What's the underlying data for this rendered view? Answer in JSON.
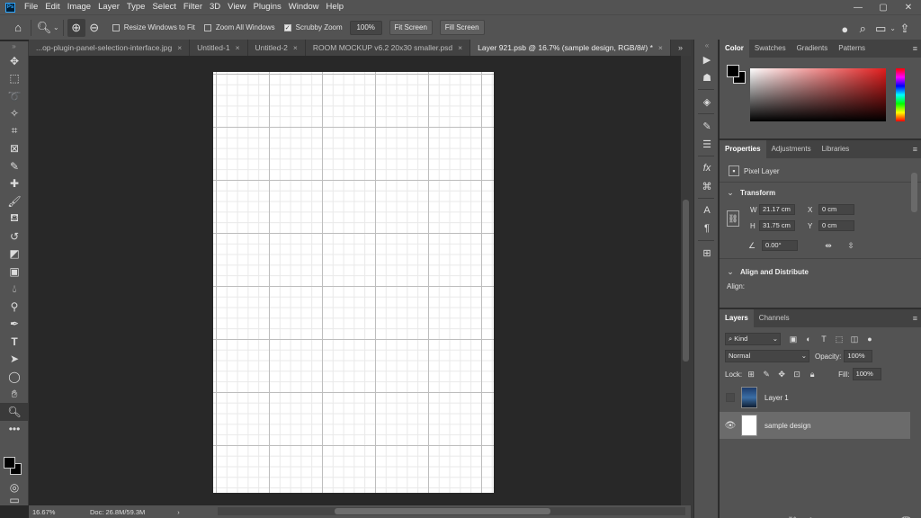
{
  "app": {
    "logo": "Ps"
  },
  "menu": [
    "File",
    "Edit",
    "Image",
    "Layer",
    "Type",
    "Select",
    "Filter",
    "3D",
    "View",
    "Plugins",
    "Window",
    "Help"
  ],
  "window_controls": {
    "minimize": "—",
    "maximize": "▢",
    "close": "✕"
  },
  "options": {
    "resize_windows": "Resize Windows to Fit",
    "zoom_all": "Zoom All Windows",
    "scrubby_zoom": "Scrubby Zoom",
    "zoom_value": "100%",
    "fit_screen": "Fit Screen",
    "fill_screen": "Fill Screen"
  },
  "tabs": [
    {
      "label": "...op-plugin-panel-selection-interface.jpg",
      "active": false
    },
    {
      "label": "Untitled-1",
      "active": false
    },
    {
      "label": "Untitled-2",
      "active": false
    },
    {
      "label": "ROOM MOCKUP v6.2 20x30 smaller.psd",
      "active": false
    },
    {
      "label": "Layer 921.psb @ 16.7% (sample design, RGB/8#) *",
      "active": true
    }
  ],
  "status": {
    "zoom": "16.67%",
    "doc": "Doc: 26.8M/59.3M",
    "arrow": "›"
  },
  "color_panel": {
    "tabs": [
      "Color",
      "Swatches",
      "Gradients",
      "Patterns"
    ]
  },
  "properties_panel": {
    "tabs": [
      "Properties",
      "Adjustments",
      "Libraries"
    ],
    "layer_type": "Pixel Layer",
    "transform_title": "Transform",
    "w_label": "W",
    "w_value": "21.17 cm",
    "h_label": "H",
    "h_value": "31.75 cm",
    "x_label": "X",
    "x_value": "0 cm",
    "y_label": "Y",
    "y_value": "0 cm",
    "angle_value": "0.00°",
    "align_title": "Align and Distribute",
    "align_label": "Align:"
  },
  "layers_panel": {
    "tabs": [
      "Layers",
      "Channels"
    ],
    "kind": "Kind",
    "blend_mode": "Normal",
    "opacity_label": "Opacity:",
    "opacity_value": "100%",
    "lock_label": "Lock:",
    "fill_label": "Fill:",
    "fill_value": "100%",
    "layers": [
      {
        "name": "Layer 1",
        "visible": false
      },
      {
        "name": "sample design",
        "visible": true,
        "selected": true
      }
    ]
  },
  "colors": {
    "accent": "#31a8ff",
    "panel": "#535353",
    "canvas_bg": "#282828"
  }
}
